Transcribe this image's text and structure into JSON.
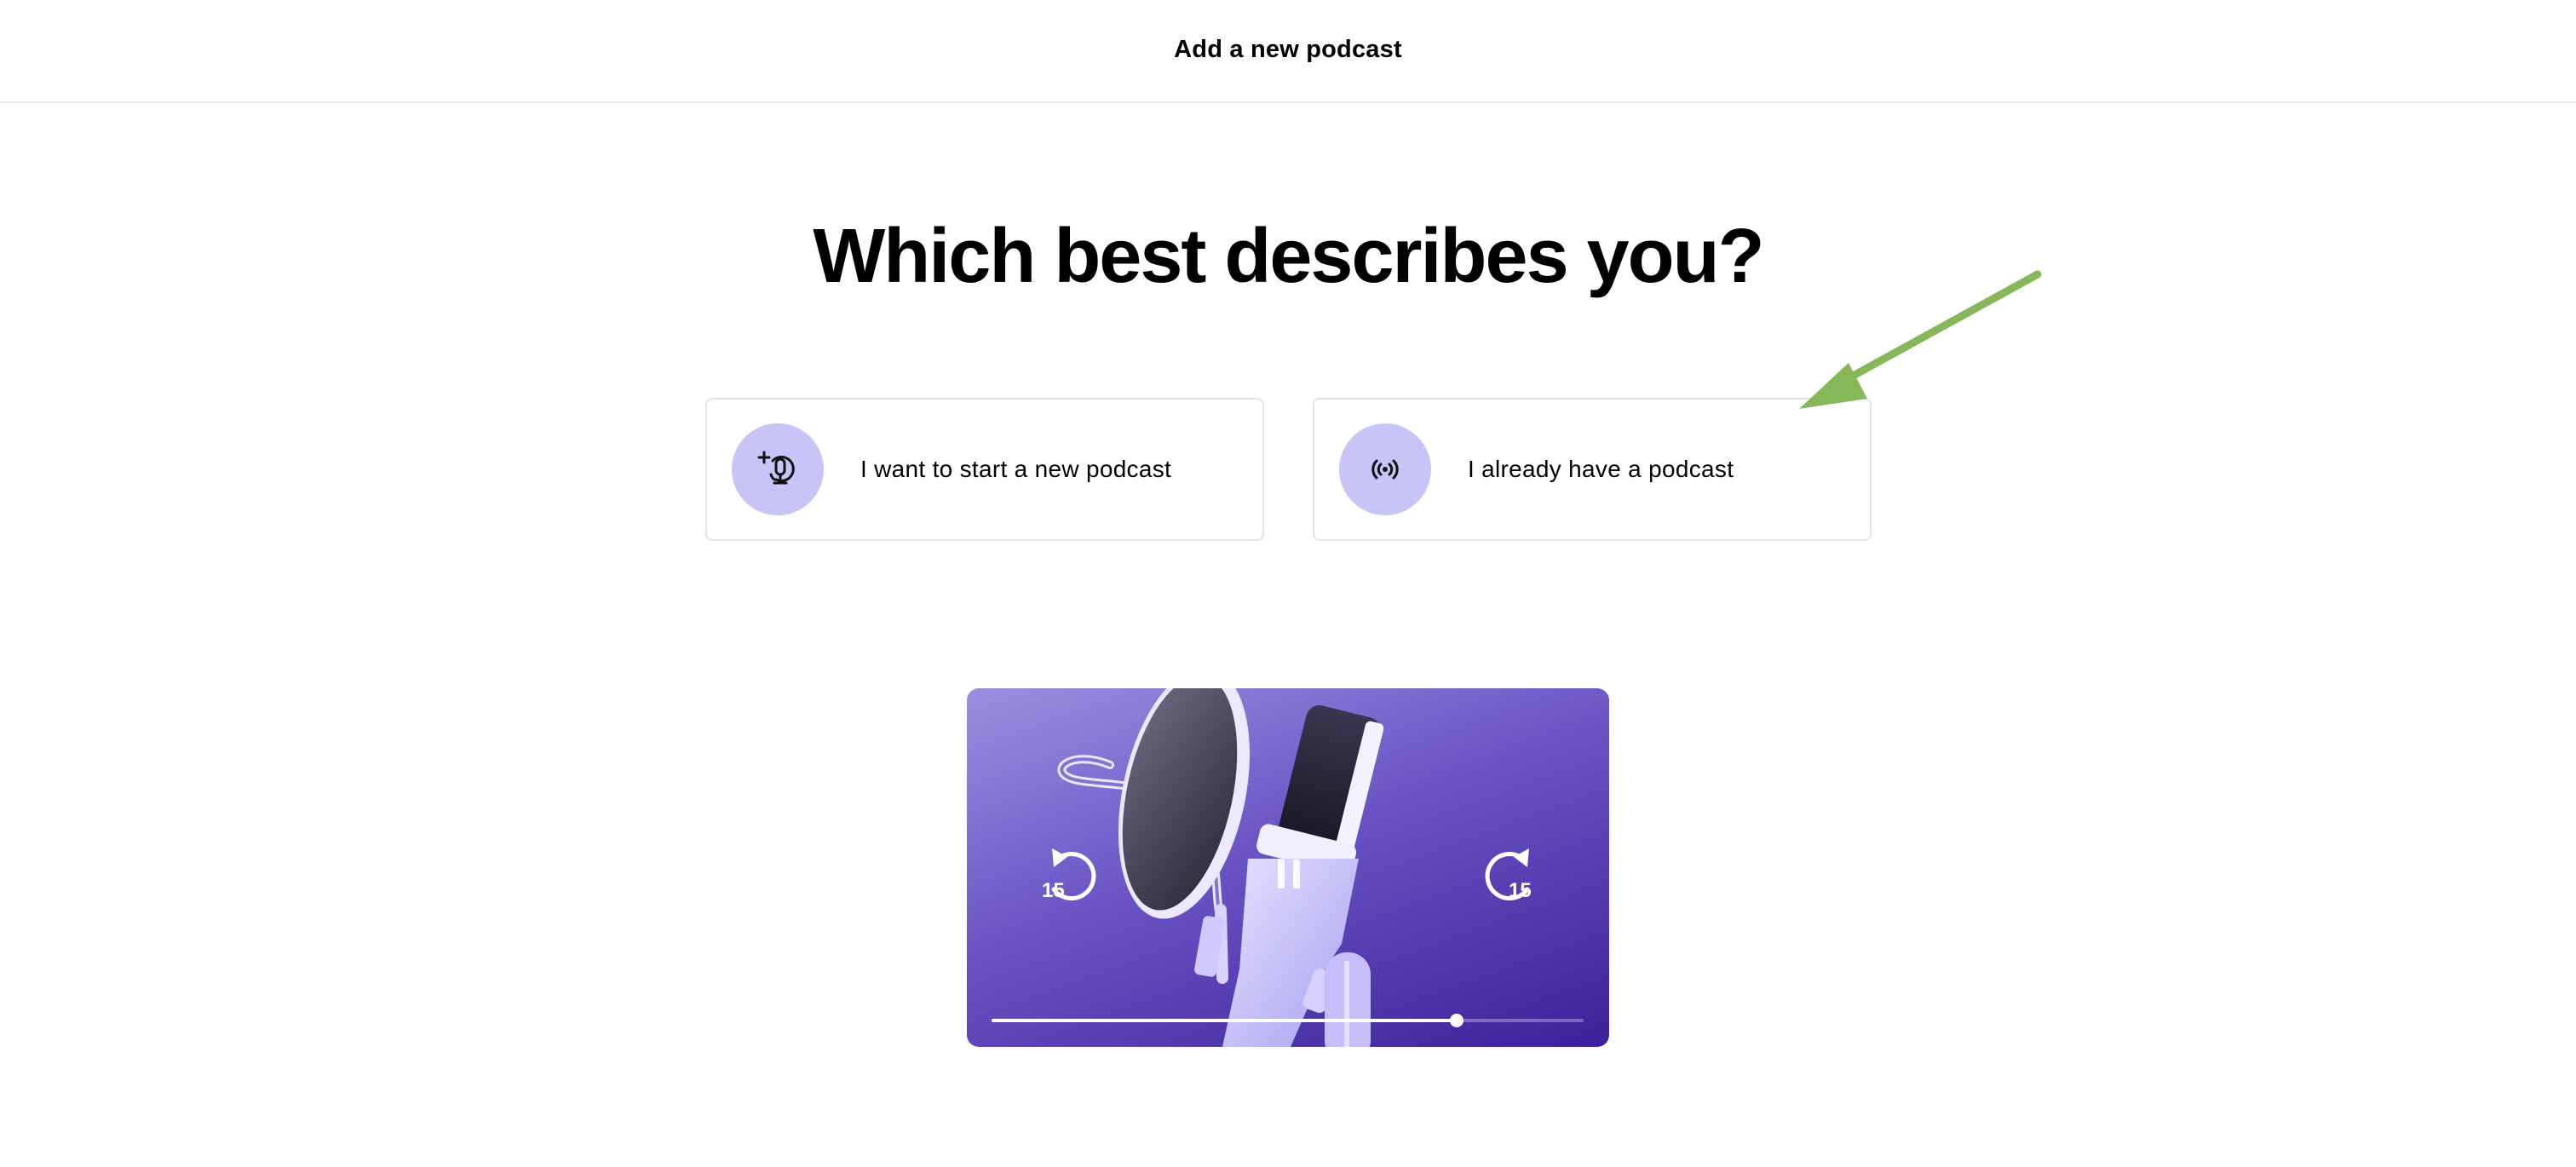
{
  "header": {
    "title": "Add a new podcast"
  },
  "main": {
    "heading": "Which best describes you?",
    "options": [
      {
        "label": "I want to start a new podcast",
        "icon": "microphone-plus-icon"
      },
      {
        "label": "I already have a podcast",
        "icon": "broadcast-icon"
      }
    ]
  },
  "player": {
    "rewind_seconds": "15",
    "forward_seconds": "15",
    "state": "playing",
    "progress_fraction": 0.785
  },
  "colors": {
    "icon_circle": "#c8c4f7",
    "annotation_arrow": "#86b85a",
    "player_gradient_start": "#9a8fe0",
    "player_gradient_end": "#3a219a"
  }
}
